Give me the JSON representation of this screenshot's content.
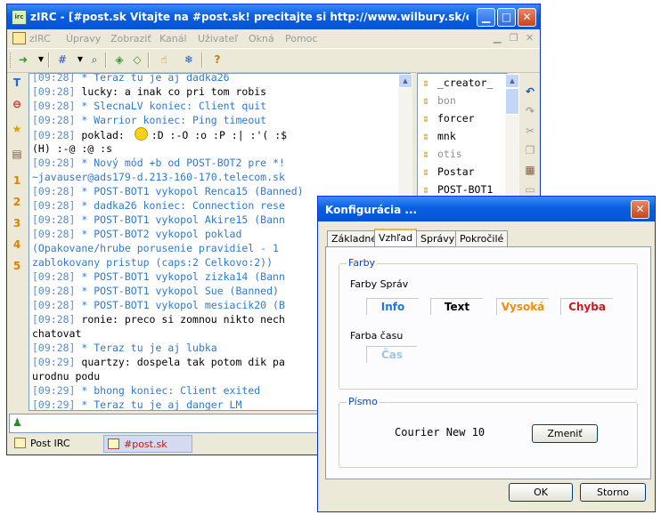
{
  "main_window": {
    "title": "zIRC - [#post.sk Vitajte na #post.sk! precitajte si http://www.wilbury.sk/com...",
    "menu": [
      "zIRC",
      "Úpravy",
      "Zobraziť",
      "Kanál",
      "Uživateľ",
      "Okná",
      "Pomoc"
    ],
    "left_tools": [
      "T",
      "⊖",
      "★",
      "▤",
      "1",
      "2",
      "3",
      "4",
      "5"
    ],
    "chat_lines": [
      {
        "ts": "[09:28]",
        "text": " * Teraz tu je aj dadka26",
        "kind": "sys"
      },
      {
        "ts": "[09:28]",
        "text": " lucky: a inak co pri tom robis",
        "kind": "msg"
      },
      {
        "ts": "[09:28]",
        "text": " * SlecnaLV koniec: Client quit",
        "kind": "sys"
      },
      {
        "ts": "[09:28]",
        "text": " * Warrior koniec: Ping timeout",
        "kind": "sys"
      },
      {
        "ts": "[09:28]",
        "text": " poklad:  :D :-O :o :P  :| :'( :$",
        "kind": "msg"
      },
      {
        "ts": "",
        "text": "(H) :-@ :@ :s",
        "kind": "cont"
      },
      {
        "ts": "[09:28]",
        "text": " * Nový mód +b od POST-BOT2 pre *!",
        "kind": "sys"
      },
      {
        "ts": "",
        "text": "~javauser@ads179-d.213-160-170.telecom.sk",
        "kind": "sys"
      },
      {
        "ts": "[09:28]",
        "text": " * POST-BOT1 vykopol Renca15 (Banned)",
        "kind": "sys"
      },
      {
        "ts": "[09:28]",
        "text": " * dadka26 koniec: Connection rese",
        "kind": "sys"
      },
      {
        "ts": "[09:28]",
        "text": " * POST-BOT1 vykopol Akire15 (Bann",
        "kind": "sys"
      },
      {
        "ts": "[09:28]",
        "text": " * POST-BOT2 vykopol poklad",
        "kind": "sys"
      },
      {
        "ts": "",
        "text": "(Opakovane/hrube porusenie pravidiel - 1",
        "kind": "sys"
      },
      {
        "ts": "",
        "text": "zablokovany pristup (caps:2 Celkovo:2))",
        "kind": "sys"
      },
      {
        "ts": "[09:28]",
        "text": " * POST-BOT1 vykopol zizka14 (Bann",
        "kind": "sys"
      },
      {
        "ts": "[09:28]",
        "text": " * POST-BOT1 vykopol Sue (Banned)",
        "kind": "sys"
      },
      {
        "ts": "[09:28]",
        "text": " * POST-BOT1 vykopol mesiacik20 (B",
        "kind": "sys"
      },
      {
        "ts": "[09:28]",
        "text": " ronie: preco si zomnou nikto nech",
        "kind": "msg"
      },
      {
        "ts": "",
        "text": "chatovat",
        "kind": "cont"
      },
      {
        "ts": "[09:28]",
        "text": " * Teraz tu je aj lubka",
        "kind": "sys"
      },
      {
        "ts": "[09:29]",
        "text": " quartzy: dospela tak potom dik pa",
        "kind": "msg"
      },
      {
        "ts": "",
        "text": "urodnu podu",
        "kind": "cont"
      },
      {
        "ts": "[09:29]",
        "text": " * bhong koniec: Client exited",
        "kind": "sys"
      },
      {
        "ts": "[09:29]",
        "text": " * Teraz tu je aj danger_LM",
        "kind": "sys"
      }
    ],
    "nicks": [
      {
        "name": "_creator_",
        "away": false
      },
      {
        "name": "bon",
        "away": true
      },
      {
        "name": "forcer",
        "away": false
      },
      {
        "name": "mnk",
        "away": false
      },
      {
        "name": "otis",
        "away": true
      },
      {
        "name": "Postar",
        "away": false
      },
      {
        "name": "POST-BOT1",
        "away": false
      }
    ],
    "window_tabs": [
      "Post IRC",
      "#post.sk"
    ],
    "active_tab": "#post.sk"
  },
  "dialog": {
    "title": "Konfigurácia ...",
    "tabs": [
      "Základné",
      "Vzhľad",
      "Správy",
      "Pokročilé"
    ],
    "active_tab": "Vzhľad",
    "colors_group": "Farby",
    "message_colors_label": "Farby Správ",
    "samples": [
      {
        "label": "Info",
        "color": "#1e78d8"
      },
      {
        "label": "Text",
        "color": "#000000"
      },
      {
        "label": "Vysoká",
        "color": "#f08c10"
      },
      {
        "label": "Chyba",
        "color": "#d01818"
      }
    ],
    "time_color_label": "Farba času",
    "time_sample": {
      "label": "Čas",
      "color": "#9cc6f0"
    },
    "font_group": "Písmo",
    "font_value": "Courier New 10",
    "change_button": "Zmeniť",
    "ok_button": "OK",
    "cancel_button": "Storno"
  }
}
